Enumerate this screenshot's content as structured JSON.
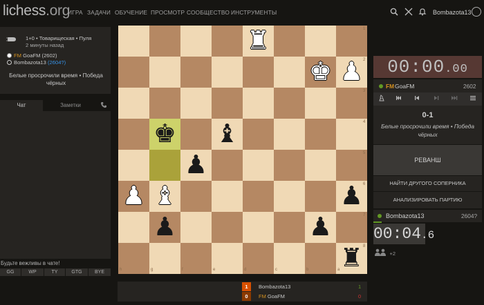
{
  "header": {
    "logo_main": "lichess",
    "logo_tld": ".org",
    "nav": [
      {
        "label": "ИГРА"
      },
      {
        "label": "ЗАДАЧИ"
      },
      {
        "label": "ОБУЧЕНИЕ"
      },
      {
        "label": "ПРОСМОТР"
      },
      {
        "label": "СООБЩЕСТВО"
      },
      {
        "label": "ИНСТРУМЕНТЫ"
      }
    ],
    "username": "Bombazota13",
    "icons": [
      "search-icon",
      "swords-icon",
      "bell-icon",
      "user-icon"
    ]
  },
  "game_info": {
    "mode": "1+0 • Товарищеская • Пуля",
    "time_ago": "2 минуты назад",
    "white": {
      "title": "FM",
      "name": "GoaFM",
      "rating": "(2602)"
    },
    "black": {
      "name": "Bombazota13",
      "rating": "(2604?)"
    },
    "result": "Белые просрочили время • Победа чёрных"
  },
  "chat": {
    "tab_chat": "Чат",
    "tab_notes": "Заметки",
    "placeholder": "Будьте вежливы в чате!",
    "presets": [
      "GG",
      "WP",
      "TY",
      "GTG",
      "BYE"
    ]
  },
  "board": {
    "files": [
      "h",
      "g",
      "f",
      "e",
      "d",
      "c",
      "b",
      "a"
    ],
    "ranks": [
      "1",
      "2",
      "3",
      "4",
      "5",
      "6",
      "7",
      "8"
    ],
    "highlights": [
      [
        3,
        1
      ],
      [
        4,
        1
      ]
    ],
    "pieces": [
      {
        "row": 0,
        "col": 4,
        "color": "white",
        "type": "rook"
      },
      {
        "row": 1,
        "col": 6,
        "color": "white",
        "type": "king"
      },
      {
        "row": 1,
        "col": 7,
        "color": "white",
        "type": "pawn"
      },
      {
        "row": 3,
        "col": 1,
        "color": "black",
        "type": "king"
      },
      {
        "row": 3,
        "col": 3,
        "color": "black",
        "type": "bishop"
      },
      {
        "row": 4,
        "col": 2,
        "color": "black",
        "type": "pawn"
      },
      {
        "row": 5,
        "col": 0,
        "color": "white",
        "type": "pawn"
      },
      {
        "row": 5,
        "col": 1,
        "color": "white",
        "type": "bishop"
      },
      {
        "row": 5,
        "col": 7,
        "color": "black",
        "type": "pawn"
      },
      {
        "row": 6,
        "col": 1,
        "color": "black",
        "type": "pawn"
      },
      {
        "row": 6,
        "col": 6,
        "color": "black",
        "type": "pawn"
      },
      {
        "row": 7,
        "col": 7,
        "color": "black",
        "type": "rook"
      }
    ]
  },
  "clocks": {
    "opponent_main": "00:00",
    "opponent_tenths": ".00",
    "me_main": "00:04",
    "me_tenths": ".6"
  },
  "opponent_row": {
    "title": "FM",
    "name": "GoaFM",
    "rating": "2602"
  },
  "me_row": {
    "name": "Bombazota13",
    "rating": "2604?"
  },
  "controls": [
    "flip-icon",
    "first-move-icon",
    "prev-move-icon",
    "next-move-icon",
    "last-move-icon",
    "menu-icon"
  ],
  "result_panel": {
    "score": "0-1",
    "text": "Белые просрочили время • Победа чёрных",
    "rematch": "РЕВАНШ",
    "new_opponent": "НАЙТИ ДРУГОГО СОПЕРНИКА",
    "analyse": "АНАЛИЗИРОВАТЬ ПАРТИЮ"
  },
  "spectators": {
    "count": "+2"
  },
  "crosstable": [
    {
      "score": "1",
      "name": "Bombazota13",
      "title": "",
      "pts": "1",
      "score_bg": "#d85000",
      "pts_color": "#629924"
    },
    {
      "score": "0",
      "title": "FM",
      "name": "GoaFM",
      "pts": "0",
      "score_bg": "#8a3a00",
      "pts_color": "#cc3333"
    }
  ],
  "colors": {
    "accent_online": "#629924",
    "title": "#d59120",
    "clock_flag": "#563833"
  }
}
